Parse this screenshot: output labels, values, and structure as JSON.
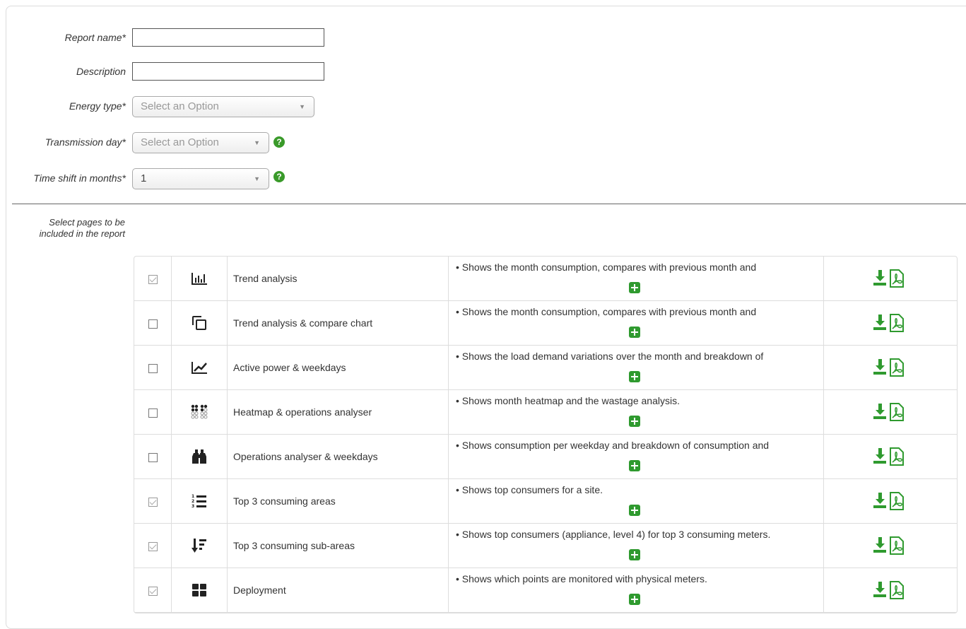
{
  "form": {
    "report_name_label": "Report name*",
    "report_name_value": "",
    "description_label": "Description",
    "description_value": "",
    "energy_type_label": "Energy type*",
    "energy_type_value": "Select an Option",
    "transmission_day_label": "Transmission day*",
    "transmission_day_value": "Select an Option",
    "time_shift_label": "Time shift in months*",
    "time_shift_value": "1",
    "help_glyph": "?"
  },
  "pages_section": {
    "label": "Select pages to be included in the report"
  },
  "pages": [
    {
      "checked": true,
      "icon": "bar-chart-icon",
      "name": "Trend analysis",
      "desc": "• Shows the month consumption, compares with previous month and"
    },
    {
      "checked": false,
      "icon": "clone-icon",
      "name": "Trend analysis & compare chart",
      "desc": "• Shows the month consumption, compares with previous month and"
    },
    {
      "checked": false,
      "icon": "line-chart-icon",
      "name": "Active power & weekdays",
      "desc": "• Shows the load demand variations over the month and breakdown of"
    },
    {
      "checked": false,
      "icon": "heatmap-dots-icon",
      "name": "Heatmap & operations analyser",
      "desc": "• Shows month heatmap and the wastage analysis."
    },
    {
      "checked": false,
      "icon": "binoculars-icon",
      "name": "Operations analyser & weekdays",
      "desc": "• Shows consumption per weekday and breakdown of consumption and"
    },
    {
      "checked": true,
      "icon": "numbered-list-icon",
      "name": "Top 3 consuming areas",
      "desc": "• Shows top consumers for a site."
    },
    {
      "checked": true,
      "icon": "sort-descending-icon",
      "name": "Top 3 consuming sub-areas",
      "desc": "• Shows top consumers (appliance, level 4) for top 3 consuming meters."
    },
    {
      "checked": true,
      "icon": "grid-blocks-icon",
      "name": "Deployment",
      "desc": "• Shows which points are monitored with physical meters."
    }
  ],
  "colors": {
    "accent_green": "#2f9a2f",
    "help_green": "#3a9a2a"
  }
}
